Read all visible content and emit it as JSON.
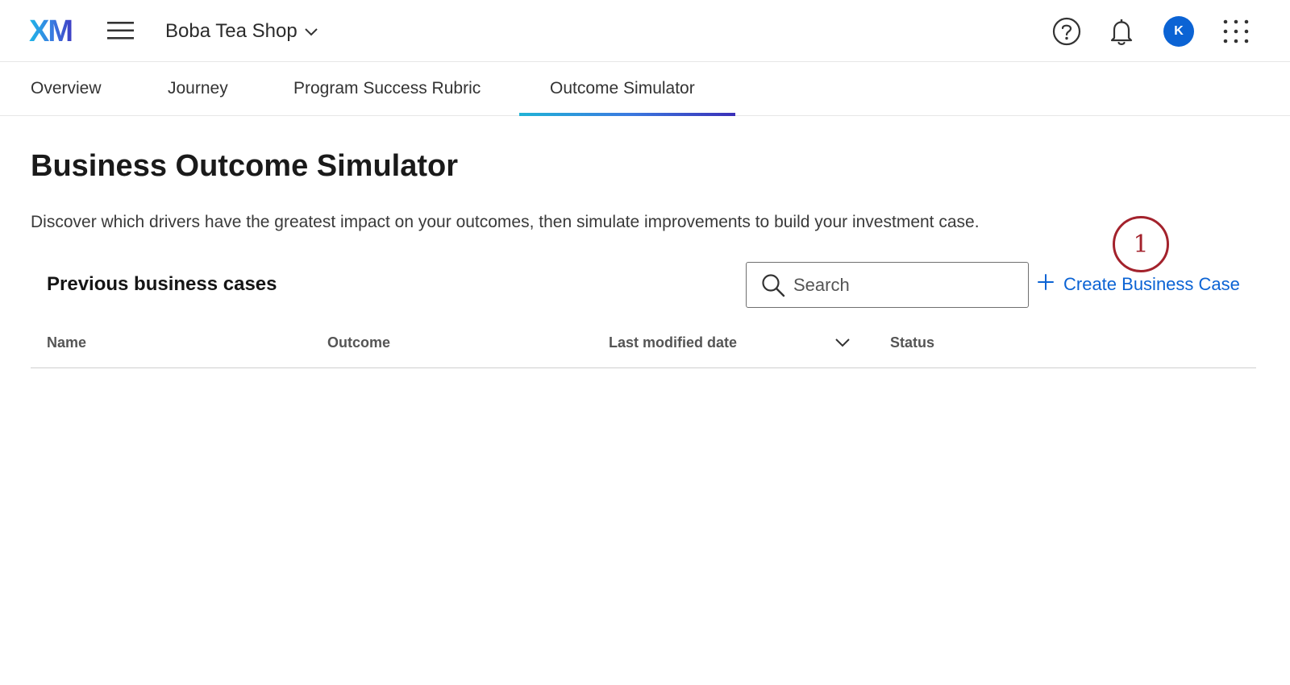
{
  "app": {
    "logo_text": "XM",
    "project_name": "Boba Tea Shop",
    "avatar_initial": "K",
    "brand_color": "#0b63d4"
  },
  "header_icons": [
    "menu-icon",
    "chevron-down-icon",
    "help-icon",
    "bell-icon",
    "apps-grid-icon"
  ],
  "tabs": [
    {
      "label": "Overview",
      "active": false
    },
    {
      "label": "Journey",
      "active": false
    },
    {
      "label": "Program Success Rubric",
      "active": false
    },
    {
      "label": "Outcome Simulator",
      "active": true
    }
  ],
  "main": {
    "title": "Business Outcome Simulator",
    "description": "Discover which drivers have the greatest impact on your outcomes, then simulate improvements to build your investment case.",
    "section_title": "Previous business cases",
    "search": {
      "placeholder": "Search",
      "value": ""
    },
    "create_button_label": "Create Business Case",
    "annotation_number": "1",
    "annotation_color": "#a3222c",
    "table": {
      "columns": [
        "Name",
        "Outcome",
        "Last modified date",
        "Status"
      ],
      "sorted_column": "Last modified date",
      "rows": []
    }
  }
}
